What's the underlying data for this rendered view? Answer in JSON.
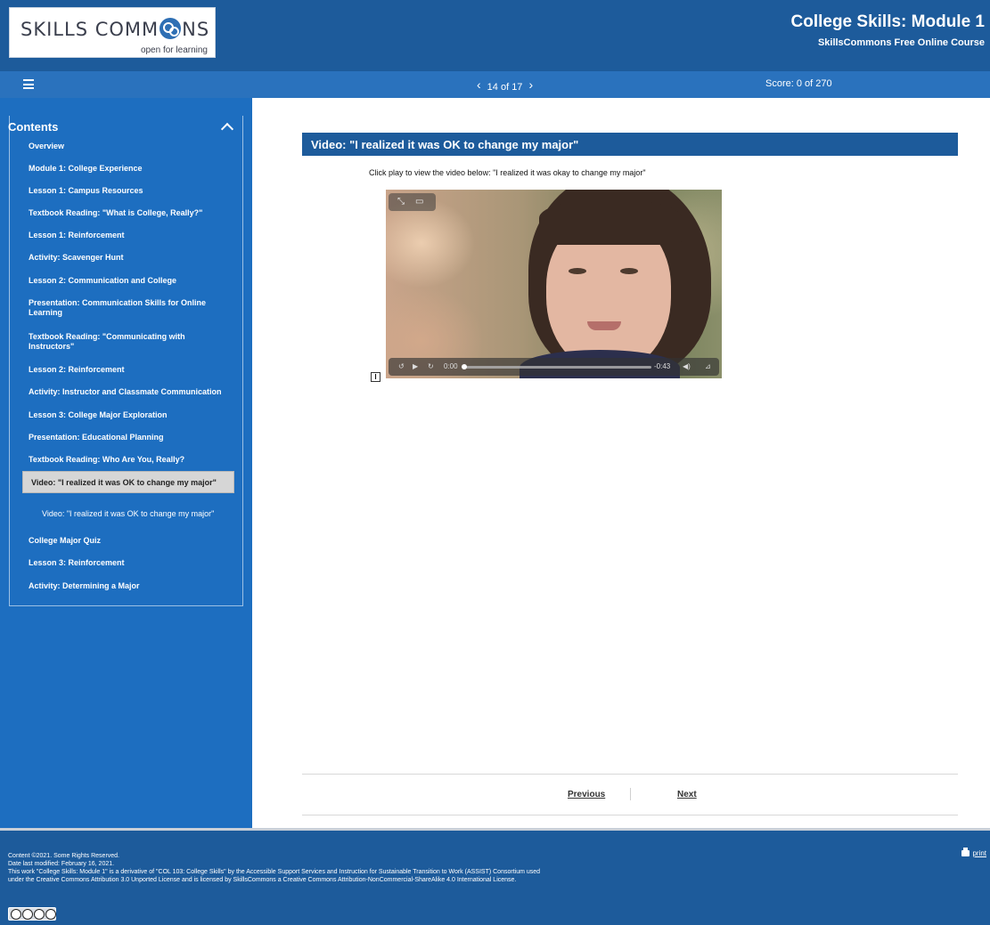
{
  "header": {
    "logo_main_before": "SKILLS COMM",
    "logo_main_after": "NS",
    "logo_sub": "open for learning",
    "course_title": "College Skills: Module 1",
    "course_subtitle": "SkillsCommons Free Online Course"
  },
  "navbar": {
    "prev_icon": "‹",
    "page_indicator": "14 of 17",
    "next_icon": "›",
    "score": "Score: 0 of 270"
  },
  "sidebar": {
    "heading": "Contents",
    "items": [
      "Overview",
      "Module 1: College Experience",
      "Lesson 1: Campus Resources",
      "Textbook Reading: \"What is College, Really?\"",
      "Lesson 1: Reinforcement",
      "Activity: Scavenger Hunt",
      "Lesson 2: Communication and College",
      "Presentation: Communication Skills for Online Learning",
      "Textbook Reading: \"Communicating with Instructors\"",
      "Lesson 2: Reinforcement",
      "Activity: Instructor and Classmate Communication",
      "Lesson 3: College Major Exploration",
      "Presentation: Educational Planning",
      "Textbook Reading: Who Are You, Really?"
    ],
    "active_item": "Video: \"I realized it was OK to change my major\"",
    "active_subitem": "Video: \"I realized it was OK to change my major\"",
    "items_after": [
      "College Major Quiz",
      "Lesson 3: Reinforcement",
      "Activity: Determining a Major"
    ]
  },
  "main": {
    "title": "Video: \"I realized it was OK to change my major\"",
    "instruction": "Click play to view the video below: \"I realized it was okay to change my major\"",
    "video": {
      "elapsed": "0:00",
      "remaining": "-0:43",
      "progress": 0
    },
    "description_marker": "I",
    "previous_label": "Previous",
    "next_label": "Next"
  },
  "footer": {
    "line1": "Content ©2021. Some Rights Reserved.",
    "line2": "Date last modified: February 16, 2021.",
    "line3": "This work \"College Skills: Module 1\" is a derivative of \"COL 103: College Skills\" by the Accessible Support Services and Instruction for Sustainable Transition to Work (ASSIST) Consortium used",
    "line4": "under the Creative Commons Attribution 3.0 Unported License and is licensed by SkillsCommons a Creative Commons Attribution-NonCommercial-ShareAlike 4.0 International License.",
    "print_label": "print"
  },
  "colors": {
    "header_bg": "#1d5b9b",
    "navbar_bg": "#2a72bd",
    "sidebar_bg": "#1d6ec0",
    "active_item_bg": "#d6d6d6"
  }
}
